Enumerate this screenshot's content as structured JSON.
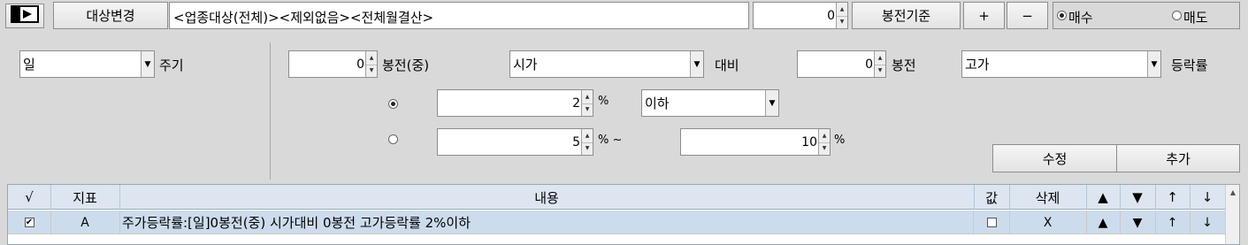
{
  "toolbar": {
    "target_change_label": "대상변경",
    "target_text": "<업종대상(전체)><제외없음><전체월결산>",
    "count_value": "0",
    "basis_label": "봉전기준",
    "plus_label": "+",
    "minus_label": "−",
    "trade_options": [
      "매수",
      "매도"
    ],
    "trade_selected": "매수"
  },
  "period": {
    "value": "일",
    "label": "주기"
  },
  "row1": {
    "bars_a_value": "0",
    "bars_a_label": "봉전(중)",
    "price_a_value": "시가",
    "compare_label": "대비",
    "bars_b_value": "0",
    "bars_b_label": "봉전",
    "price_b_value": "고가",
    "rate_label": "등락률"
  },
  "cond1": {
    "selected": true,
    "value": "2",
    "unit": "%",
    "op_value": "이하"
  },
  "cond2": {
    "selected": false,
    "from_value": "5",
    "unit_from": "% ~",
    "to_value": "10",
    "unit_to": "%"
  },
  "actions": {
    "modify_label": "수정",
    "add_label": "추가"
  },
  "table": {
    "headers": {
      "check": "√",
      "indicator": "지표",
      "content": "내용",
      "value": "값",
      "delete": "삭제",
      "top": "▲",
      "bottom": "▼",
      "up": "↑",
      "down": "↓"
    },
    "rows": [
      {
        "checked": true,
        "indicator": "A",
        "content": "주가등락률:[일]0봉전(중) 시가대비 0봉전 고가등락률 2%이하",
        "value_checked": false,
        "delete": "X",
        "top": "▲",
        "bottom": "▼",
        "up": "↑",
        "down": "↓"
      }
    ]
  },
  "colors": {
    "background": "#d9d9d9",
    "header_bg": "#dde6f0",
    "selected_row": "#cddcec"
  }
}
